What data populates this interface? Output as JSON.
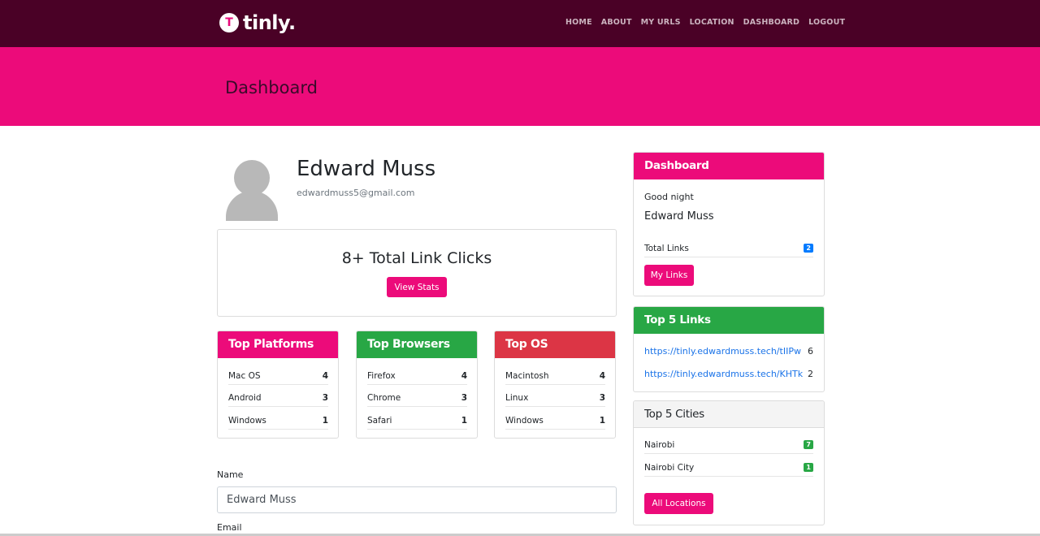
{
  "brand": {
    "logo_letter": "T",
    "name": "tinly."
  },
  "nav": {
    "items": [
      "HOME",
      "ABOUT",
      "MY URLS",
      "LOCATION",
      "DASHBOARD",
      "LOGOUT"
    ]
  },
  "hero": {
    "title": "Dashboard"
  },
  "profile": {
    "name": "Edward Muss",
    "email": "edwardmuss5@gmail.com"
  },
  "clicks": {
    "title": "8+ Total Link Clicks",
    "button": "View Stats"
  },
  "top_platforms": {
    "title": "Top Platforms",
    "rows": [
      {
        "label": "Mac OS",
        "value": "4"
      },
      {
        "label": "Android",
        "value": "3"
      },
      {
        "label": "Windows",
        "value": "1"
      }
    ]
  },
  "top_browsers": {
    "title": "Top Browsers",
    "rows": [
      {
        "label": "Firefox",
        "value": "4"
      },
      {
        "label": "Chrome",
        "value": "3"
      },
      {
        "label": "Safari",
        "value": "1"
      }
    ]
  },
  "top_os": {
    "title": "Top OS",
    "rows": [
      {
        "label": "Macintosh",
        "value": "4"
      },
      {
        "label": "Linux",
        "value": "3"
      },
      {
        "label": "Windows",
        "value": "1"
      }
    ]
  },
  "form": {
    "name_label": "Name",
    "name_value": "Edward Muss",
    "email_label": "Email"
  },
  "sidebar": {
    "dashboard": {
      "title": "Dashboard",
      "greeting": "Good night",
      "name": "Edward Muss",
      "total_links_label": "Total Links",
      "total_links_value": "2",
      "button": "My Links"
    },
    "top_links": {
      "title": "Top 5 Links",
      "rows": [
        {
          "url": "https://tinly.edwardmuss.tech/tIIPw",
          "value": "6"
        },
        {
          "url": "https://tinly.edwardmuss.tech/KHTkj",
          "value": "2"
        }
      ]
    },
    "top_cities": {
      "title": "Top 5 Cities",
      "rows": [
        {
          "label": "Nairobi",
          "value": "7"
        },
        {
          "label": "Nairobi City",
          "value": "1"
        }
      ],
      "button": "All Locations"
    }
  },
  "colors": {
    "navbar": "#4a0126",
    "accent": "#ec0b7a",
    "green": "#28a745",
    "red": "#dc3545",
    "blue": "#007bff"
  }
}
